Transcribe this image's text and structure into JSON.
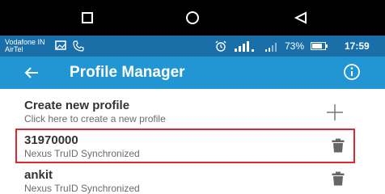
{
  "colors": {
    "statusbar": "#1a6fa8",
    "appbar": "#2196d3",
    "highlight": "#e0262e",
    "trash": "#666666"
  },
  "nav": {
    "recent_icon": "square-icon",
    "home_icon": "circle-icon",
    "back_icon": "triangle-back-icon"
  },
  "status": {
    "carrier_line1": "Vodafone IN",
    "carrier_line2": "AirTel",
    "battery": "73%",
    "time": "17:59"
  },
  "appbar": {
    "title": "Profile Manager"
  },
  "create": {
    "title": "Create new profile",
    "subtitle": "Click here to create a new profile"
  },
  "profiles": [
    {
      "name": "31970000",
      "status": "Nexus TruID Synchronized"
    },
    {
      "name": "ankit",
      "status": "Nexus TruID Synchronized"
    }
  ]
}
